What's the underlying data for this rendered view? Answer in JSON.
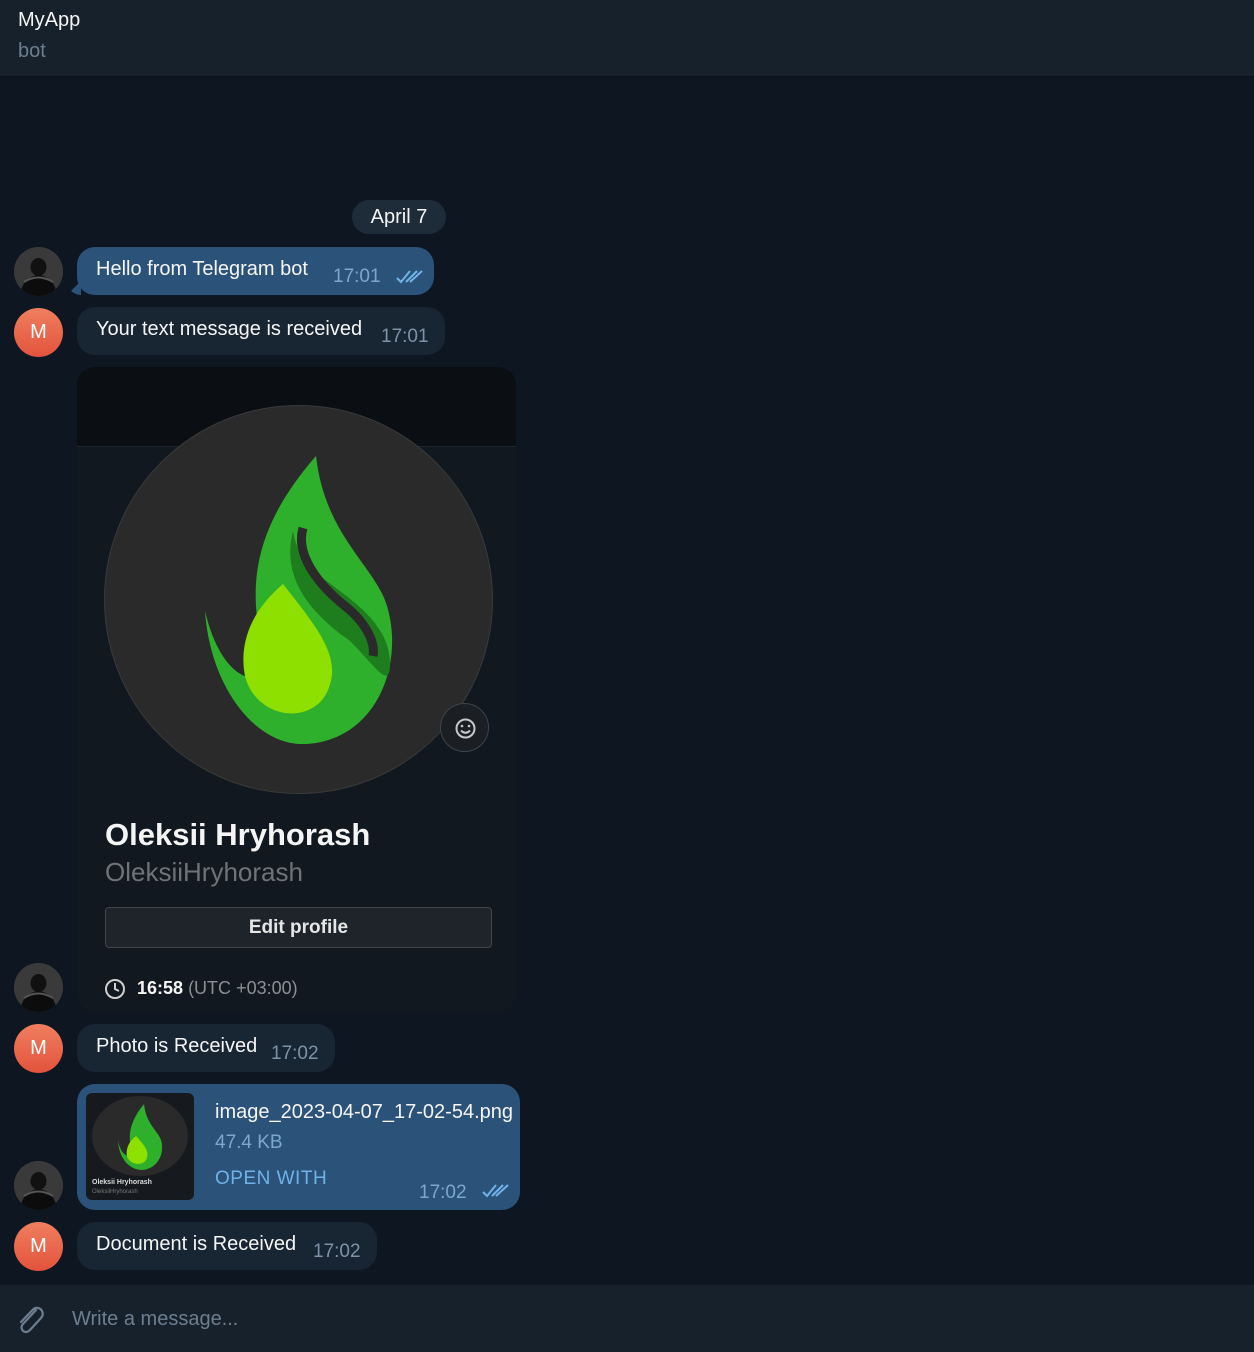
{
  "header": {
    "title": "MyApp",
    "subtitle": "bot"
  },
  "chat": {
    "date_separator": "April 7",
    "messages": [
      {
        "direction": "outgoing",
        "text": "Hello from Telegram bot",
        "time": "17:01"
      },
      {
        "direction": "incoming",
        "avatar_letter": "M",
        "text": "Your text message is received",
        "time": "17:01"
      },
      {
        "direction": "outgoing",
        "type": "photo",
        "profile_card": {
          "name": "Oleksii Hryhorash",
          "handle": "OleksiiHryhorash",
          "edit_button": "Edit profile",
          "local_time": "16:58",
          "timezone": "(UTC +03:00)"
        }
      },
      {
        "direction": "incoming",
        "avatar_letter": "M",
        "text": "Photo is Received",
        "time": "17:02"
      },
      {
        "direction": "outgoing",
        "type": "file",
        "file_name": "image_2023-04-07_17-02-54.png",
        "file_size": "47.4 KB",
        "action": "OPEN WITH",
        "time": "17:02",
        "thumb_name": "Oleksii Hryhorash",
        "thumb_handle": "OleksiiHryhorash"
      },
      {
        "direction": "incoming",
        "avatar_letter": "M",
        "text": "Document is Received",
        "time": "17:02"
      }
    ]
  },
  "composer": {
    "placeholder": "Write a message..."
  },
  "colors": {
    "background": "#0e1621",
    "outgoing_bubble": "#2b5278",
    "incoming_bubble": "#182533",
    "accent": "#6fb3ea"
  },
  "icons": [
    "attach-icon",
    "read-ticks-icon",
    "clock-icon",
    "emoji-icon"
  ]
}
